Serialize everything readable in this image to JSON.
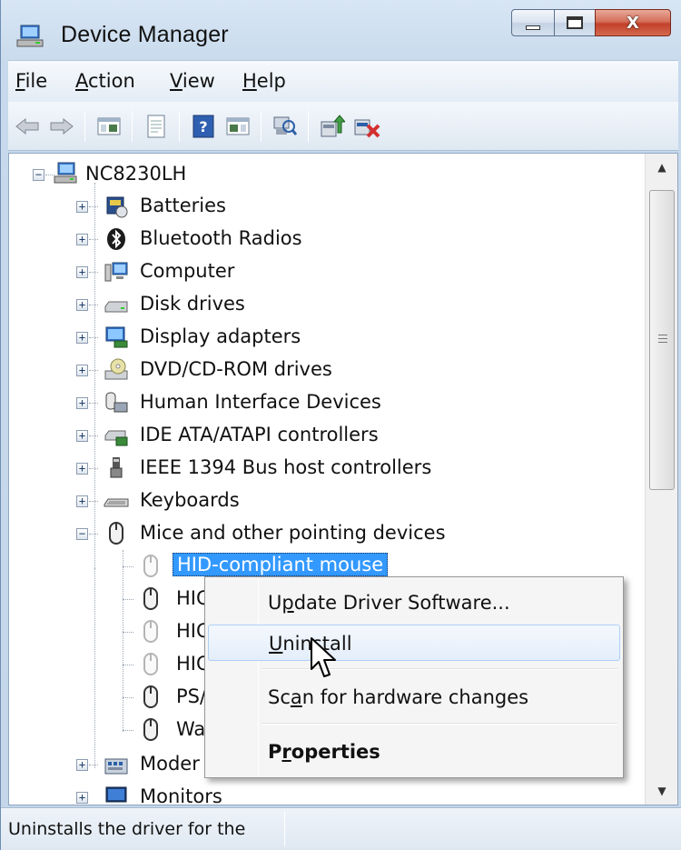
{
  "window": {
    "title": "Device Manager"
  },
  "menu": [
    {
      "label": "File",
      "mnemonic": "F",
      "rest": "ile"
    },
    {
      "label": "Action",
      "mnemonic": "A",
      "rest": "ction"
    },
    {
      "label": "View",
      "mnemonic": "V",
      "rest": "iew"
    },
    {
      "label": "Help",
      "mnemonic": "H",
      "rest": "elp"
    }
  ],
  "toolbar": {
    "buttons": [
      "back-icon",
      "forward-icon",
      "show-hide-tree-icon",
      "properties-icon",
      "help-icon",
      "console-tree-icon",
      "scan-hardware-icon",
      "update-driver-icon",
      "uninstall-icon"
    ]
  },
  "tree": {
    "root": "NC8230LH",
    "categories": [
      {
        "label": "Batteries",
        "icon": "battery-icon",
        "expanded": false
      },
      {
        "label": "Bluetooth Radios",
        "icon": "bluetooth-icon",
        "expanded": false
      },
      {
        "label": "Computer",
        "icon": "computer-icon",
        "expanded": false
      },
      {
        "label": "Disk drives",
        "icon": "disk-drive-icon",
        "expanded": false
      },
      {
        "label": "Display adapters",
        "icon": "display-adapter-icon",
        "expanded": false
      },
      {
        "label": "DVD/CD-ROM drives",
        "icon": "dvd-drive-icon",
        "expanded": false
      },
      {
        "label": "Human Interface Devices",
        "icon": "hid-icon",
        "expanded": false
      },
      {
        "label": "IDE ATA/ATAPI controllers",
        "icon": "ide-controller-icon",
        "expanded": false
      },
      {
        "label": "IEEE 1394 Bus host controllers",
        "icon": "firewire-icon",
        "expanded": false
      },
      {
        "label": "Keyboards",
        "icon": "keyboard-icon",
        "expanded": false
      },
      {
        "label": "Mice and other pointing devices",
        "icon": "mouse-icon",
        "expanded": true
      }
    ],
    "mice_children": [
      {
        "label": "HID-compliant mouse",
        "selected": true,
        "disabled_icon": true
      },
      {
        "label": "HIC",
        "selected": false,
        "disabled_icon": false
      },
      {
        "label": "HIC",
        "selected": false,
        "disabled_icon": true
      },
      {
        "label": "HIC",
        "selected": false,
        "disabled_icon": true
      },
      {
        "label": "PS/",
        "selected": false,
        "disabled_icon": false
      },
      {
        "label": "Wa",
        "selected": false,
        "disabled_icon": false
      }
    ],
    "after": [
      {
        "label": "Moder",
        "icon": "modem-icon"
      },
      {
        "label": "Monitors",
        "icon": "monitor-icon"
      }
    ]
  },
  "context_menu": {
    "items": [
      {
        "label_pre": "U",
        "label_mn": "p",
        "label_post": "date Driver Software...",
        "bold": false,
        "hover": false
      },
      {
        "label_pre": "",
        "label_mn": "U",
        "label_post": "ninstall",
        "bold": false,
        "hover": true
      },
      {
        "label_pre": "Sc",
        "label_mn": "a",
        "label_post": "n for hardware changes",
        "bold": false,
        "hover": false
      },
      {
        "label_pre": "P",
        "label_mn": "r",
        "label_post": "operties",
        "bold": true,
        "hover": false
      }
    ]
  },
  "statusbar": {
    "text": "Uninstalls the driver for the"
  },
  "colors": {
    "selection": "#3399ff",
    "title_close": "#c3402a",
    "frame": "#c4d6e9"
  }
}
